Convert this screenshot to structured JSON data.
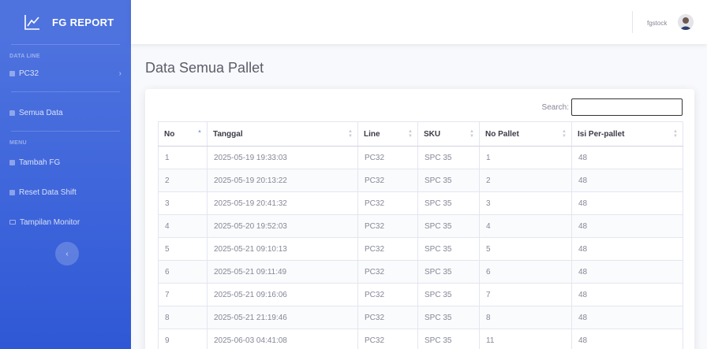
{
  "sidebar": {
    "brand": "FG REPORT",
    "heading_data": "DATA LINE",
    "heading_menu": "MENU",
    "items": [
      {
        "label": "PC32",
        "icon": "file-icon"
      },
      {
        "label": "Semua Data",
        "icon": "folder-icon"
      },
      {
        "label": "Tambah FG",
        "icon": "file-icon"
      },
      {
        "label": "Reset Data Shift",
        "icon": "file-icon"
      },
      {
        "label": "Tampilan Monitor",
        "icon": "monitor-icon"
      }
    ],
    "toggle_glyph": "‹",
    "chevron_glyph": "›"
  },
  "topbar": {
    "username": "fgstock"
  },
  "page": {
    "title": "Data Semua Pallet"
  },
  "search": {
    "label": "Search:",
    "value": ""
  },
  "table": {
    "headers": [
      "No",
      "Tanggal",
      "Line",
      "SKU",
      "No Pallet",
      "Isi Per-pallet"
    ],
    "rows": [
      [
        "1",
        "2025-05-19 19:33:03",
        "PC32",
        "SPC 35",
        "1",
        "48"
      ],
      [
        "2",
        "2025-05-19 20:13:22",
        "PC32",
        "SPC 35",
        "2",
        "48"
      ],
      [
        "3",
        "2025-05-19 20:41:32",
        "PC32",
        "SPC 35",
        "3",
        "48"
      ],
      [
        "4",
        "2025-05-20 19:52:03",
        "PC32",
        "SPC 35",
        "4",
        "48"
      ],
      [
        "5",
        "2025-05-21 09:10:13",
        "PC32",
        "SPC 35",
        "5",
        "48"
      ],
      [
        "6",
        "2025-05-21 09:11:49",
        "PC32",
        "SPC 35",
        "6",
        "48"
      ],
      [
        "7",
        "2025-05-21 09:16:06",
        "PC32",
        "SPC 35",
        "7",
        "48"
      ],
      [
        "8",
        "2025-05-21 21:19:46",
        "PC32",
        "SPC 35",
        "8",
        "48"
      ],
      [
        "9",
        "2025-06-03 04:41:08",
        "PC32",
        "SPC 35",
        "11",
        "48"
      ]
    ]
  },
  "colors": {
    "sidebar_top": "#4e73df",
    "sidebar_bottom": "#2f58d6",
    "text_muted": "#858796"
  }
}
